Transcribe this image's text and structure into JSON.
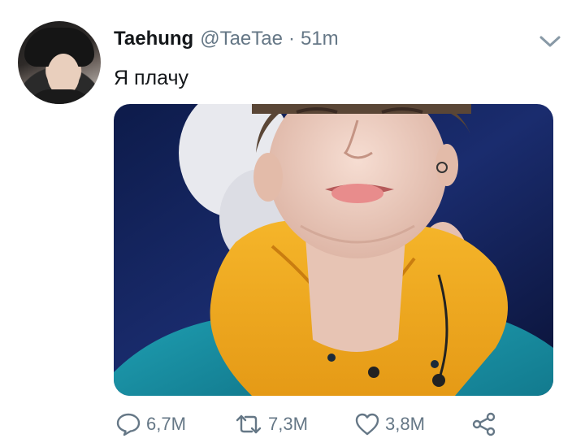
{
  "tweet": {
    "author": {
      "display_name": "Taehung",
      "handle": "@TaeTae",
      "separator": "·",
      "time": "51m"
    },
    "text": "Я плачу",
    "actions": {
      "reply_count": "6,7M",
      "retweet_count": "7,3M",
      "like_count": "3,8M"
    },
    "icons": {
      "reply": "speech-bubble-icon",
      "retweet": "retweet-arrows-icon",
      "like": "heart-outline-icon",
      "share": "share-nodes-icon",
      "menu": "chevron-down-icon"
    },
    "colors": {
      "text_primary": "#14171a",
      "text_secondary": "#657786",
      "background": "#ffffff"
    }
  }
}
